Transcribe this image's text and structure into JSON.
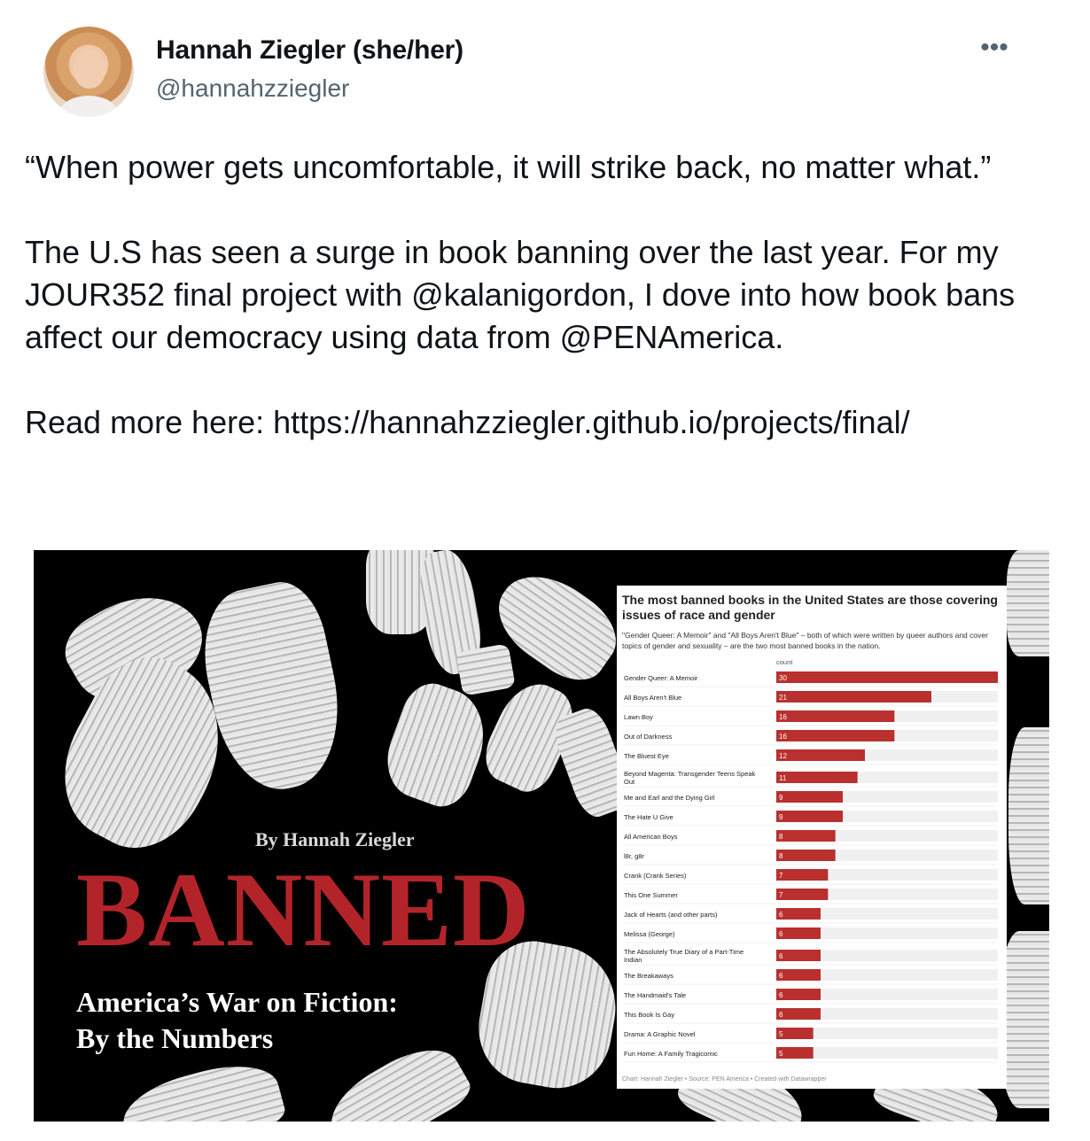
{
  "tweet": {
    "author_name": "Hannah Ziegler (she/her)",
    "author_handle": "@hannahzziegler",
    "more_icon": "more-icon",
    "text": "“When power gets uncomfortable, it will strike back, no matter what.”\n\nThe U.S has seen a surge in book banning over the last year. For my JOUR352 final project with @kalanigordon, I dove into how book bans affect our democracy using data from @PENAmerica.\n\nRead more here: https://hannahzziegler.github.io/projects/final/"
  },
  "media": {
    "byline": "By Hannah Ziegler",
    "headline": "BANNED",
    "subtitle_line1": "America’s War on Fiction:",
    "subtitle_line2": "By the Numbers",
    "headline_color": "#b3242a"
  },
  "chart_data": {
    "type": "bar",
    "title": "The most banned books in the United States are those covering issues of race and gender",
    "subtitle": "\"Gender Queer: A Memoir\" and \"All Boys Aren't Blue\" – both of which were written by queer authors and cover topics of gender and sexuality – are the two most banned books in the nation.",
    "value_header": "count",
    "source": "Chart: Hannah Ziegler • Source: PEN America • Created with Datawrapper",
    "bar_color": "#b9302e",
    "xlim": [
      0,
      30
    ],
    "categories": [
      "Gender Queer: A Memoir",
      "All Boys Aren't Blue",
      "Lawn Boy",
      "Out of Darkness",
      "The Bluest Eye",
      "Beyond Magenta: Transgender Teens Speak Out",
      "Me and Earl and the Dying Girl",
      "The Hate U Give",
      "All American Boys",
      "l8r, g8r",
      "Crank (Crank Series)",
      "This One Summer",
      "Jack of Hearts (and other parts)",
      "Melissa (George)",
      "The Absolutely True Diary of a Part-Time Indian",
      "The Breakaways",
      "The Handmaid's Tale",
      "This Book Is Gay",
      "Drama: A Graphic Novel",
      "Fun Home: A Family Tragicomic"
    ],
    "values": [
      30,
      21,
      16,
      16,
      12,
      11,
      9,
      9,
      8,
      8,
      7,
      7,
      6,
      6,
      6,
      6,
      6,
      6,
      5,
      5
    ]
  }
}
